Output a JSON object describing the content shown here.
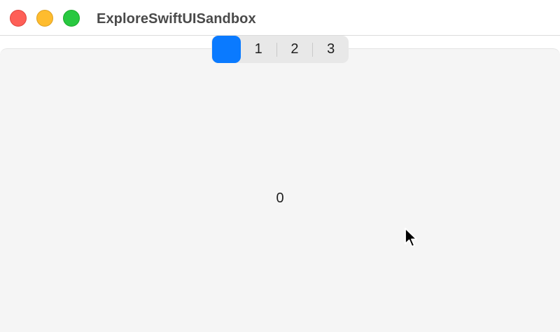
{
  "window": {
    "title": "ExploreSwiftUISandbox"
  },
  "segmented_control": {
    "segments": [
      {
        "label": "",
        "selected": true
      },
      {
        "label": "1",
        "selected": false
      },
      {
        "label": "2",
        "selected": false
      },
      {
        "label": "3",
        "selected": false
      }
    ],
    "accent_color": "#0a7aff"
  },
  "content": {
    "value": "0"
  },
  "colors": {
    "close": "#fe5f57",
    "minimize": "#febc2e",
    "zoom": "#28c840",
    "content_background": "#f5f5f5"
  }
}
